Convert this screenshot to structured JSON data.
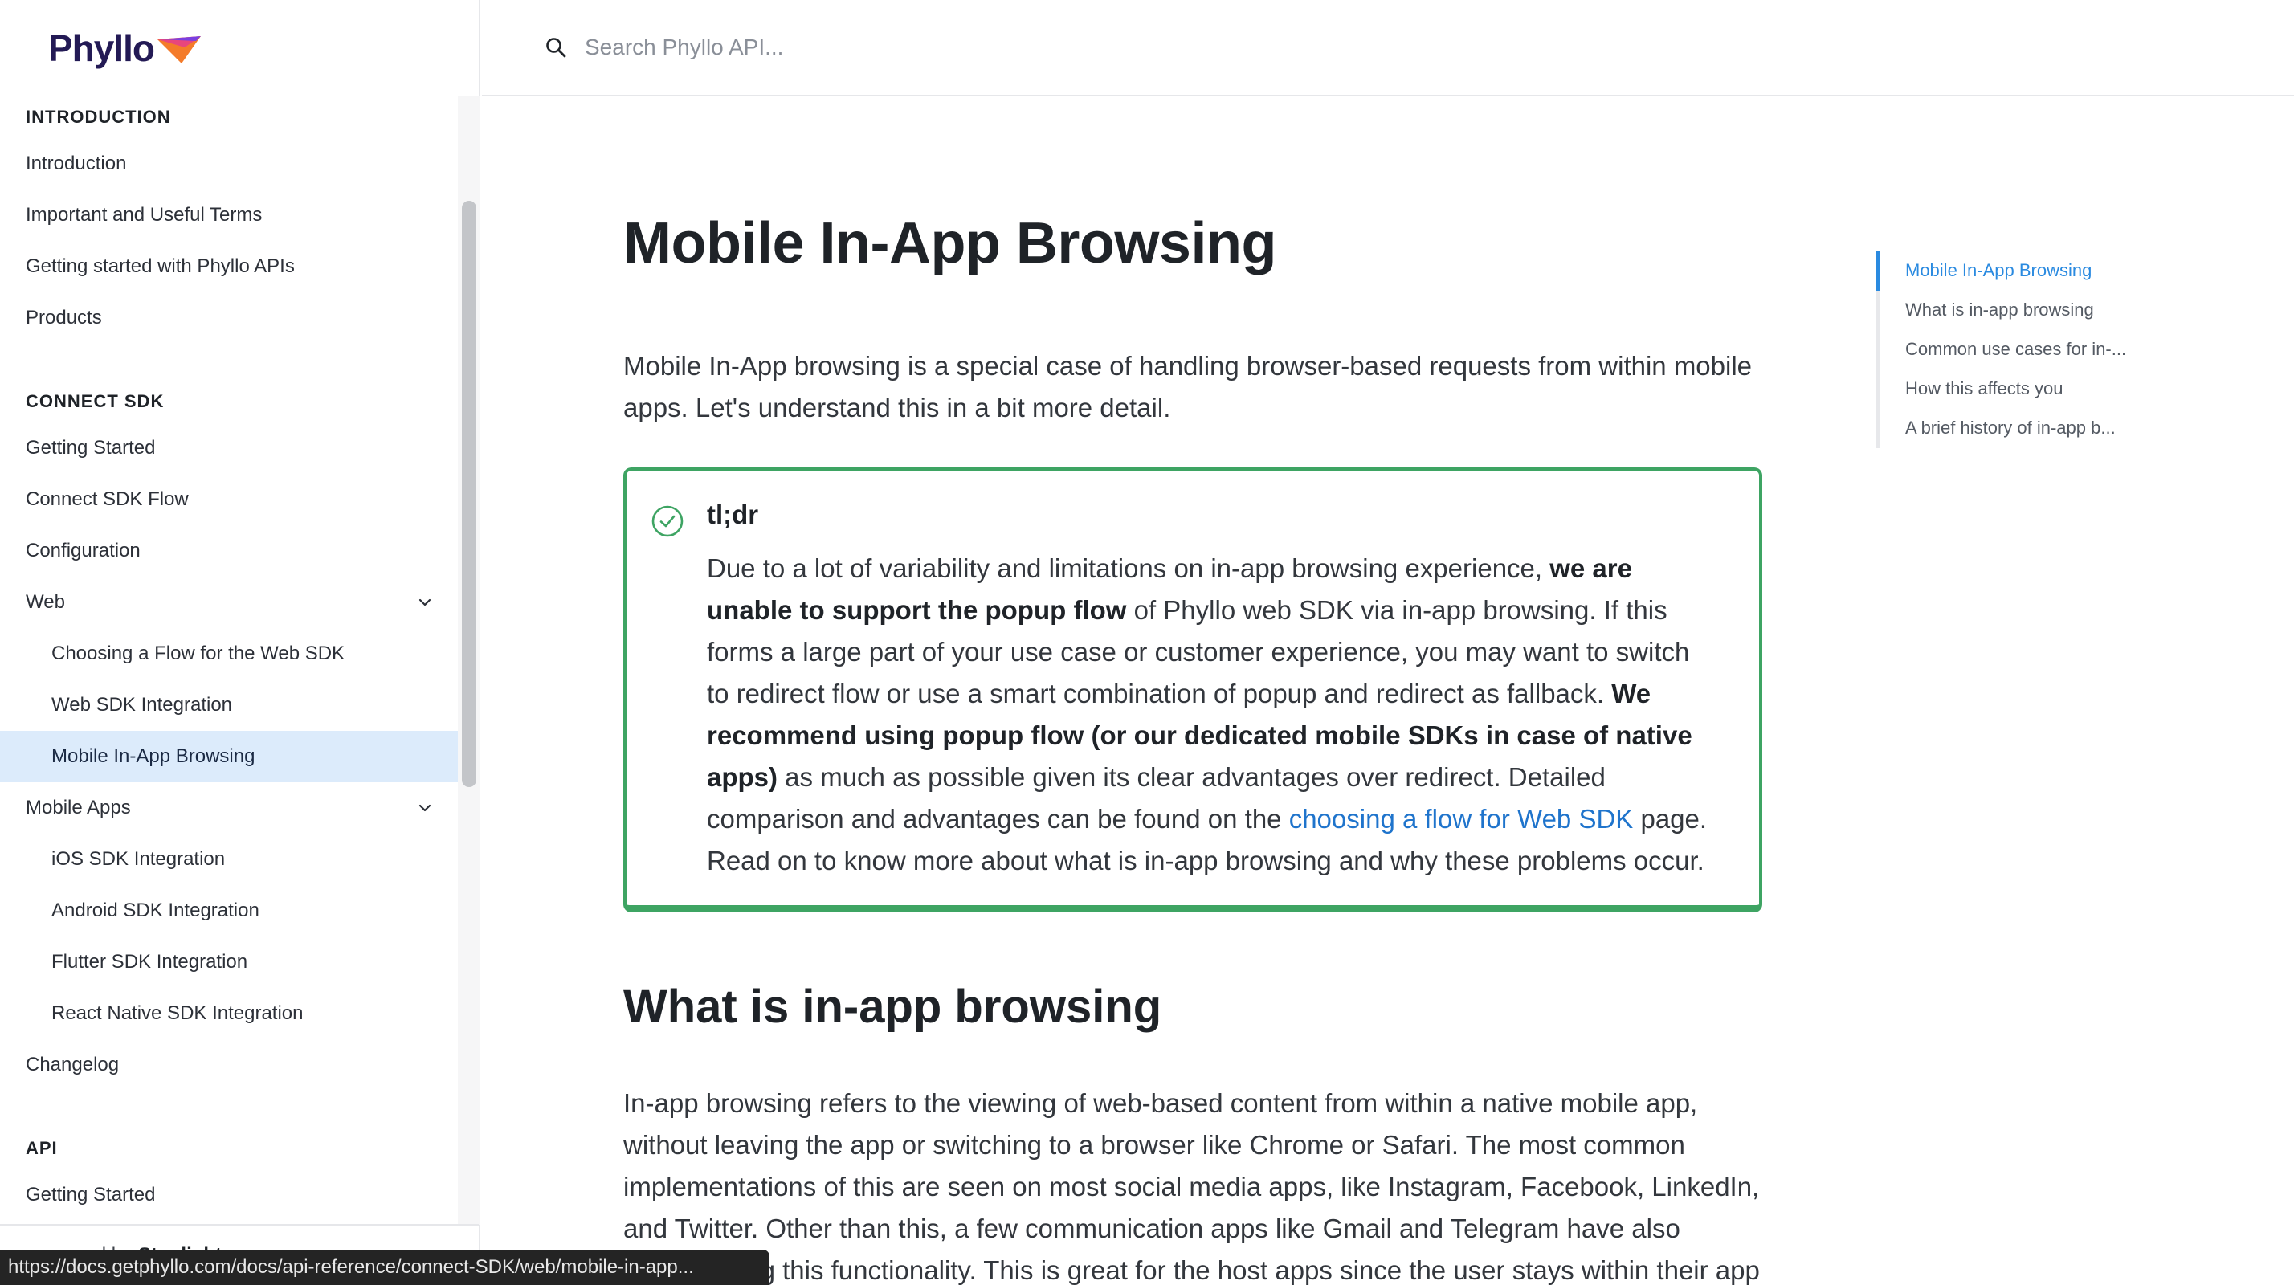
{
  "brand": {
    "name": "Phyllo"
  },
  "search": {
    "placeholder": "Search Phyllo API..."
  },
  "sidebar": {
    "sections": [
      {
        "title": "INTRODUCTION",
        "items": [
          {
            "label": "Introduction",
            "level": 1
          },
          {
            "label": "Important and Useful Terms",
            "level": 1
          },
          {
            "label": "Getting started with Phyllo APIs",
            "level": 1
          },
          {
            "label": "Products",
            "level": 1
          }
        ]
      },
      {
        "title": "CONNECT SDK",
        "items": [
          {
            "label": "Getting Started",
            "level": 1
          },
          {
            "label": "Connect SDK Flow",
            "level": 1
          },
          {
            "label": "Configuration",
            "level": 1
          },
          {
            "label": "Web",
            "level": 1,
            "expandable": true
          },
          {
            "label": "Choosing a Flow for the Web SDK",
            "level": 2
          },
          {
            "label": "Web SDK Integration",
            "level": 2
          },
          {
            "label": "Mobile In-App Browsing",
            "level": 2,
            "active": true
          },
          {
            "label": "Mobile Apps",
            "level": 1,
            "expandable": true
          },
          {
            "label": "iOS SDK Integration",
            "level": 2
          },
          {
            "label": "Android SDK Integration",
            "level": 2
          },
          {
            "label": "Flutter SDK Integration",
            "level": 2
          },
          {
            "label": "React Native SDK Integration",
            "level": 2
          },
          {
            "label": "Changelog",
            "level": 1
          }
        ]
      },
      {
        "title": "API",
        "items": [
          {
            "label": "Getting Started",
            "level": 1
          }
        ]
      }
    ],
    "footer": {
      "prefix": "powered by",
      "name": "Stoplight"
    }
  },
  "article": {
    "title": "Mobile In-App Browsing",
    "intro": "Mobile In-App browsing is a special case of handling browser-based requests from within mobile apps. Let's understand this in a bit more detail.",
    "callout": {
      "title": "tl;dr",
      "p1": "Due to a lot of variability and limitations on in-app browsing experience, ",
      "b1": "we are unable to support the popup flow",
      "p2": " of Phyllo web SDK via in-app browsing. If this forms a large part of your use case or customer experience, you may want to switch to redirect flow or use a smart combination of popup and redirect as fallback. ",
      "b2": "We recommend using popup flow (or our dedicated mobile SDKs in case of native apps)",
      "p3": " as much as possible given its clear advantages over redirect. Detailed comparison and advantages can be found on the ",
      "link": "choosing a flow for Web SDK",
      "p4": " page. Read on to know more about what is in-app browsing and why these problems occur."
    },
    "h2": "What is in-app browsing",
    "paragraph": "In-app browsing refers to the viewing of web-based content from within a native mobile app, without leaving the app or switching to a browser like Chrome or Safari. The most common implementations of this are seen on most social media apps, like Instagram, Facebook, LinkedIn, and Twitter. Other than this, a few communication apps like Gmail and Telegram have also started using this functionality. This is great for the host apps since the user stays within their app"
  },
  "toc": {
    "items": [
      {
        "label": "Mobile In-App Browsing",
        "active": true
      },
      {
        "label": "What is in-app browsing"
      },
      {
        "label": "Common use cases for in-..."
      },
      {
        "label": "How this affects you"
      },
      {
        "label": "A brief history of in-app b..."
      }
    ]
  },
  "status_url": "https://docs.getphyllo.com/docs/api-reference/connect-SDK/web/mobile-in-app...",
  "colors": {
    "accent": "#2a8ae0",
    "callout_border": "#3ea463",
    "active_nav_bg": "#dcebfb",
    "link": "#1f74cc"
  }
}
